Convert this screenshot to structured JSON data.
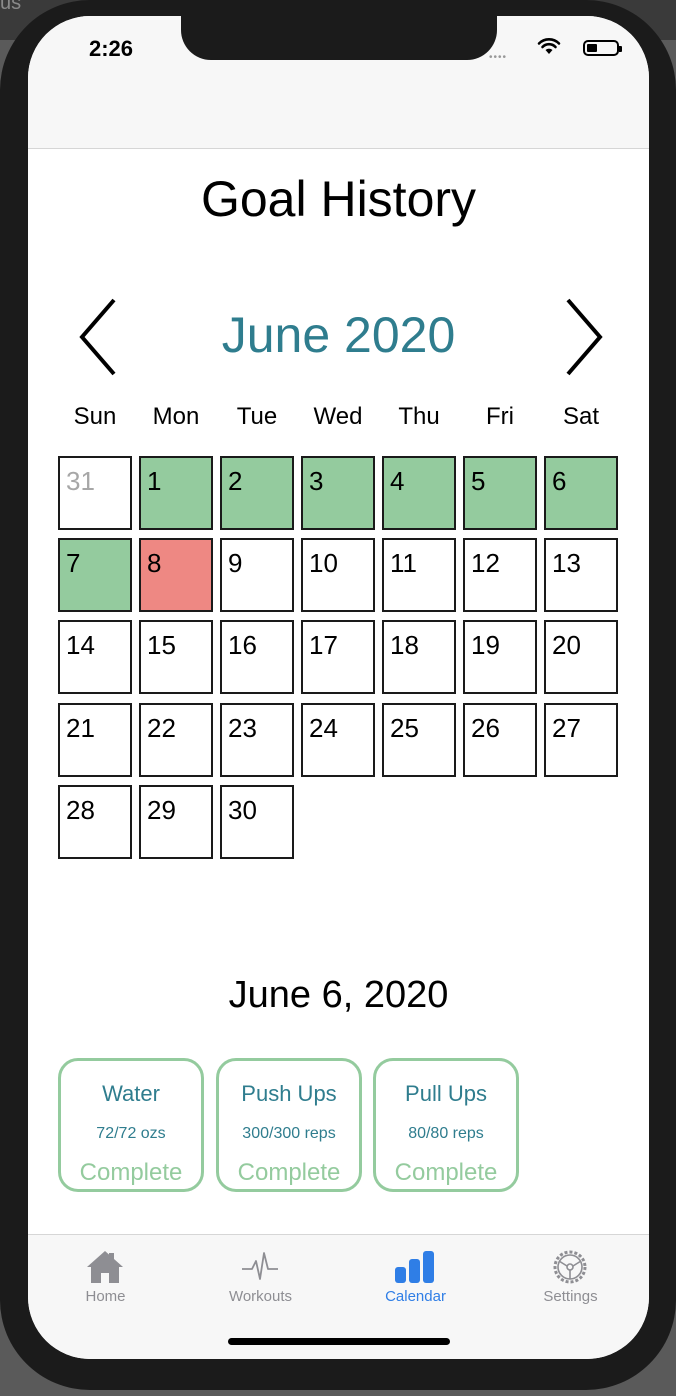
{
  "status": {
    "time": "2:26"
  },
  "page": {
    "title": "Goal History",
    "month_label": "June 2020"
  },
  "calendar": {
    "weekdays": [
      "Sun",
      "Mon",
      "Tue",
      "Wed",
      "Thu",
      "Fri",
      "Sat"
    ],
    "days": [
      {
        "label": "31",
        "state": "outside"
      },
      {
        "label": "1",
        "state": "met"
      },
      {
        "label": "2",
        "state": "met"
      },
      {
        "label": "3",
        "state": "met"
      },
      {
        "label": "4",
        "state": "met"
      },
      {
        "label": "5",
        "state": "met"
      },
      {
        "label": "6",
        "state": "met"
      },
      {
        "label": "7",
        "state": "met"
      },
      {
        "label": "8",
        "state": "missed"
      },
      {
        "label": "9",
        "state": "none"
      },
      {
        "label": "10",
        "state": "none"
      },
      {
        "label": "11",
        "state": "none"
      },
      {
        "label": "12",
        "state": "none"
      },
      {
        "label": "13",
        "state": "none"
      },
      {
        "label": "14",
        "state": "none"
      },
      {
        "label": "15",
        "state": "none"
      },
      {
        "label": "16",
        "state": "none"
      },
      {
        "label": "17",
        "state": "none"
      },
      {
        "label": "18",
        "state": "none"
      },
      {
        "label": "19",
        "state": "none"
      },
      {
        "label": "20",
        "state": "none"
      },
      {
        "label": "21",
        "state": "none"
      },
      {
        "label": "22",
        "state": "none"
      },
      {
        "label": "23",
        "state": "none"
      },
      {
        "label": "24",
        "state": "none"
      },
      {
        "label": "25",
        "state": "none"
      },
      {
        "label": "26",
        "state": "none"
      },
      {
        "label": "27",
        "state": "none"
      },
      {
        "label": "28",
        "state": "none"
      },
      {
        "label": "29",
        "state": "none"
      },
      {
        "label": "30",
        "state": "none"
      }
    ]
  },
  "selected": {
    "date_label": "June 6, 2020",
    "goals": [
      {
        "name": "Water",
        "progress": "72/72 ozs",
        "status": "Complete"
      },
      {
        "name": "Push Ups",
        "progress": "300/300 reps",
        "status": "Complete"
      },
      {
        "name": "Pull Ups",
        "progress": "80/80 reps",
        "status": "Complete"
      }
    ]
  },
  "tabbar": {
    "items": [
      {
        "label": "Home",
        "icon": "home-icon",
        "active": false
      },
      {
        "label": "Workouts",
        "icon": "heartbeat-icon",
        "active": false
      },
      {
        "label": "Calendar",
        "icon": "bar-chart-icon",
        "active": true
      },
      {
        "label": "Settings",
        "icon": "gear-icon",
        "active": false
      }
    ]
  },
  "colors": {
    "accent_teal": "#2f7d8e",
    "goal_met_green": "#94cb9e",
    "goal_missed_red": "#ee8883",
    "tab_active_blue": "#2f7ee6",
    "tab_inactive_gray": "#8e8e93"
  }
}
